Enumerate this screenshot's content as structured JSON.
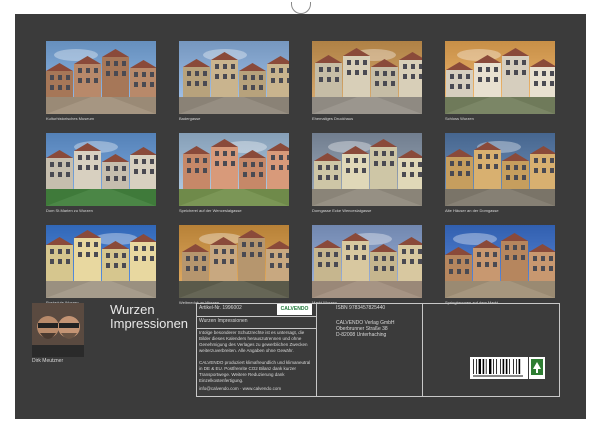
{
  "photos": [
    {
      "caption": "Kulturhistorisches Museum",
      "palette": {
        "sky": "#7fa8d6",
        "building": "#b8896a",
        "ground": "#9a8a76"
      }
    },
    {
      "caption": "Badergasse",
      "palette": {
        "sky": "#8fb0d8",
        "building": "#c9b48e",
        "ground": "#8a8276"
      }
    },
    {
      "caption": "Ehemaliges Druckhaus",
      "palette": {
        "sky": "#c89a5e",
        "building": "#d8cfb8",
        "ground": "#8f8a82"
      }
    },
    {
      "caption": "Schloss Wurzen",
      "palette": {
        "sky": "#e0a860",
        "building": "#e8e0d0",
        "ground": "#6f7a5a"
      }
    },
    {
      "caption": "Dom St.Marien zu Wurzen",
      "palette": {
        "sky": "#6d9ad0",
        "building": "#d8d0c0",
        "ground": "#3f7a3a"
      }
    },
    {
      "caption": "Speicherei auf der Wenceslaigasse",
      "palette": {
        "sky": "#9fb8d0",
        "building": "#d89a7a",
        "ground": "#6f8a4a"
      }
    },
    {
      "caption": "Domgasse Ecke Wenceslaigasse",
      "palette": {
        "sky": "#8a97a8",
        "building": "#e0d8b8",
        "ground": "#8a8478"
      }
    },
    {
      "caption": "Alte Häuser an der Domgasse",
      "palette": {
        "sky": "#5f7fa8",
        "building": "#d8b070",
        "ground": "#7a7468"
      }
    },
    {
      "caption": "Postadule Wurzen",
      "palette": {
        "sky": "#4a80d0",
        "building": "#e8d8a0",
        "ground": "#9a9080"
      }
    },
    {
      "caption": "Weltmeduk zu Wurzen",
      "palette": {
        "sky": "#d09a50",
        "building": "#c8a880",
        "ground": "#5a5a4a"
      }
    },
    {
      "caption": "Markt Wurzen",
      "palette": {
        "sky": "#8aa0c8",
        "building": "#d8c8a0",
        "ground": "#9a8878"
      }
    },
    {
      "caption": "Springbrunnen auf dem Markt",
      "palette": {
        "sky": "#4a78c8",
        "building": "#c89870",
        "ground": "#9a8a72"
      }
    }
  ],
  "author": {
    "name": "Dirk Meutzner"
  },
  "calendar": {
    "title_line1": "Wurzen",
    "title_line2": "Impressionen"
  },
  "info": {
    "article_no": "Artikel-Nr. 1996002",
    "subtitle": "Wurzen Impressionen",
    "description": "Intolge besonderer Schutzrechte ist es untersagt, die Bilder dieses Kalenders herauszutrennen und ohne Genehmigung des Verlages zu gewerblichen Zwecken weiterzuverbreiten. Alle Angaben ohne Gewähr.",
    "eco_note": "CALVENDO produziert klimafreundlich und klimaneutral in DE & EU. Postfrenrite CO2 Bilanz dank kurzer Transportwege. Weitere Reduzierung dank Einzelkostenfertigung.",
    "website": "info@calvendo.com · www.calvendo.com",
    "logo_text": "CALVENDO",
    "isbn": "ISBN 9783457825440",
    "publisher_name": "CALVENDO Verlag GmbH",
    "publisher_street": "Oberbrunner Straße 38",
    "publisher_city": "D-82008 Unterhaching"
  },
  "colors": {
    "sheet": "#3b3b3b",
    "text": "#d8d8d8",
    "frame": "#c8c8c8",
    "brand": "#1f7a3a"
  }
}
